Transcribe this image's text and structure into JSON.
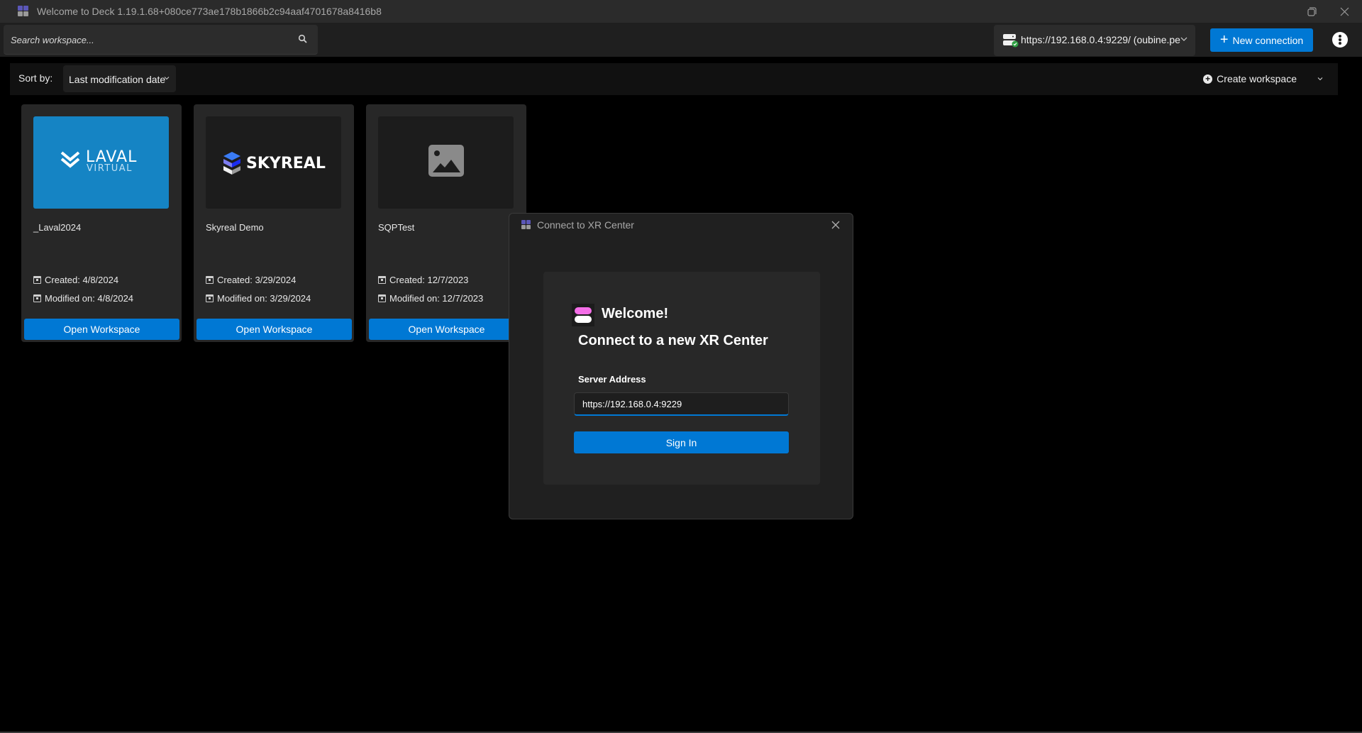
{
  "window": {
    "title": "Welcome to Deck 1.19.1.68+080ce773ae178b1866b2c94aaf4701678a8416b8",
    "icon": "deck-app-icon",
    "controls": [
      "restore-icon",
      "close-icon"
    ]
  },
  "topbar": {
    "search_placeholder": "Search workspace...",
    "search_value": "",
    "server": {
      "label": "https://192.168.0.4:9229/ (oubine.pe",
      "status": "connected",
      "status_color": "#2ea043"
    },
    "new_connection_label": "New connection",
    "more_icon": "more-vertical-icon"
  },
  "sortbar": {
    "sort_label": "Sort by:",
    "sort_value": "Last modification date",
    "create_workspace_label": "Create workspace"
  },
  "workspaces": [
    {
      "name": "_Laval2024",
      "thumbnail": "laval-virtual-logo",
      "thumbnail_text": [
        "LAVAL",
        "VIRTUAL"
      ],
      "created": "Created: 4/8/2024",
      "modified": "Modified on: 4/8/2024",
      "open_label": "Open Workspace"
    },
    {
      "name": "Skyreal Demo",
      "thumbnail": "skyreal-logo",
      "thumbnail_text": [
        "SKYREAL"
      ],
      "created": "Created: 3/29/2024",
      "modified": "Modified on: 3/29/2024",
      "open_label": "Open Workspace"
    },
    {
      "name": "SQPTest",
      "thumbnail": "image-placeholder-icon",
      "thumbnail_text": [],
      "created": "Created: 12/7/2023",
      "modified": "Modified on: 12/7/2023",
      "open_label": "Open Workspace"
    }
  ],
  "dialog": {
    "title": "Connect to XR Center",
    "welcome": "Welcome!",
    "heading": "Connect to a new XR Center",
    "server_label": "Server Address",
    "server_value": "https://192.168.0.4:9229",
    "signin_label": "Sign In"
  },
  "colors": {
    "accent": "#0078d4",
    "laval_blue": "#1584c4",
    "welcome_pink": "#f56ee8"
  }
}
